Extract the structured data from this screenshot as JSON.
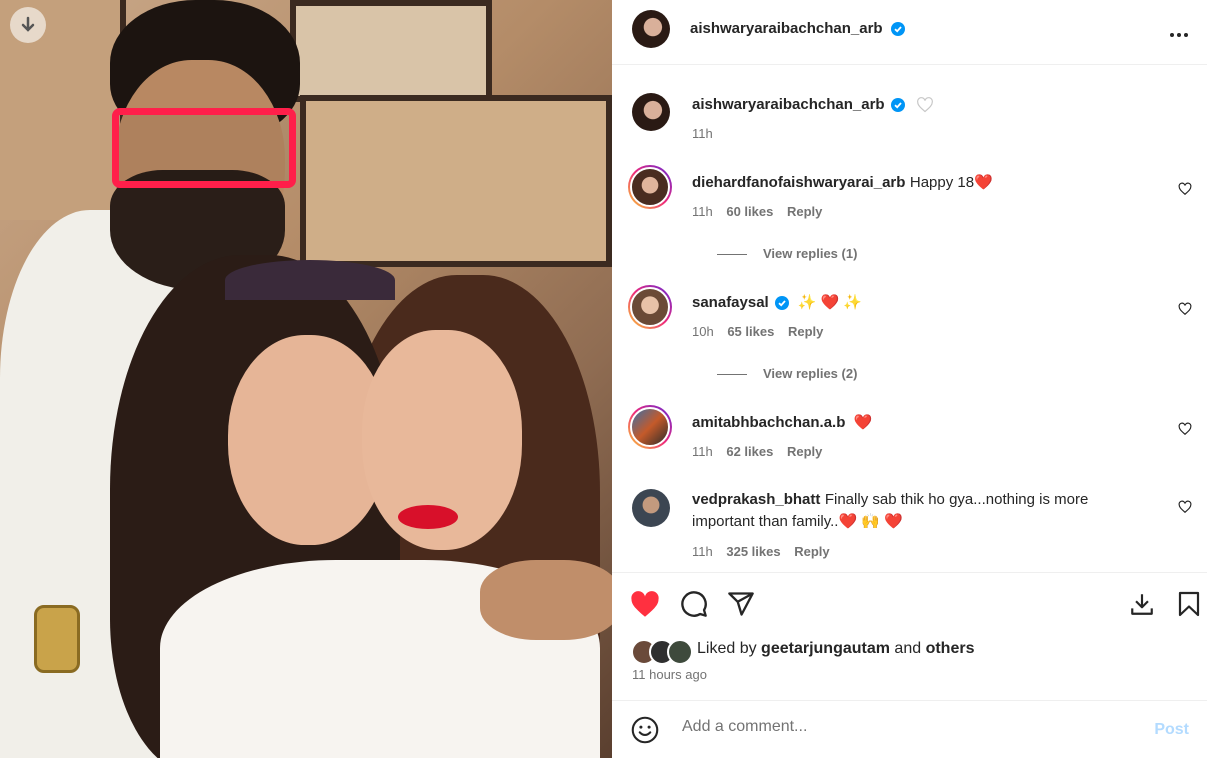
{
  "post": {
    "author": "aishwaryaraibachchan_arb",
    "caption_time": "11h",
    "liked_by_prefix": "Liked by",
    "liked_by_user": "geetarjungautam",
    "liked_by_and": "and",
    "liked_by_others": "others",
    "time_ago": "11 hours ago",
    "more_icon": "more-horizontal-icon"
  },
  "comments": [
    {
      "user": "diehardfanofaishwaryarai_arb",
      "text": "Happy 18❤️",
      "time": "11h",
      "likes": "60 likes",
      "reply": "Reply",
      "view_replies": "View replies (1)"
    },
    {
      "user": "sanafaysal",
      "text": "✨ ❤️ ✨",
      "time": "10h",
      "likes": "65 likes",
      "reply": "Reply",
      "view_replies": "View replies (2)"
    },
    {
      "user": "amitabhbachchan.a.b",
      "text": "❤️",
      "time": "11h",
      "likes": "62 likes",
      "reply": "Reply"
    },
    {
      "user": "vedprakash_bhatt",
      "text": "Finally sab thik ho gya...nothing is more important than family..❤️ 🙌 ❤️",
      "time": "11h",
      "likes": "325 likes",
      "reply": "Reply"
    }
  ],
  "add_comment": {
    "placeholder": "Add a comment...",
    "post_label": "Post"
  },
  "colors": {
    "heart_red": "#ff3040",
    "verified_blue": "#0095f6",
    "post_disabled": "#b3dbff"
  }
}
